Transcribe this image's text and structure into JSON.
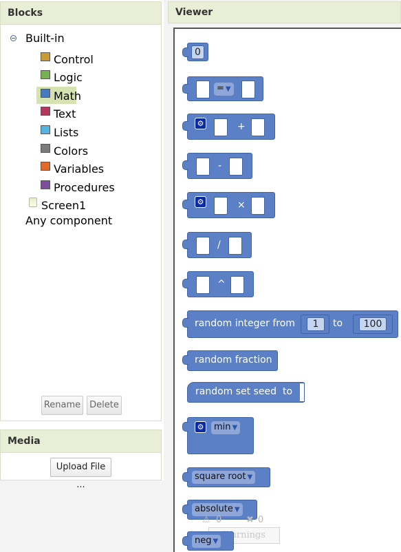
{
  "blocks_panel": {
    "title": "Blocks",
    "builtin_label": "Built-in",
    "categories": [
      {
        "label": "Control",
        "color": "#c99a38"
      },
      {
        "label": "Logic",
        "color": "#77b150"
      },
      {
        "label": "Math",
        "color": "#4a79c4"
      },
      {
        "label": "Text",
        "color": "#b3385e"
      },
      {
        "label": "Lists",
        "color": "#54b3e0"
      },
      {
        "label": "Colors",
        "color": "#7b7b7b"
      },
      {
        "label": "Variables",
        "color": "#e06a2c"
      },
      {
        "label": "Procedures",
        "color": "#7d4f9a"
      }
    ],
    "selected": "Math",
    "screen_label": "Screen1",
    "any_component": "Any component",
    "rename_label": "Rename",
    "delete_label": "Delete"
  },
  "media_panel": {
    "title": "Media",
    "upload_label": "Upload File ..."
  },
  "viewer": {
    "title": "Viewer",
    "blocks": {
      "number_value": "0",
      "compare_op": "=",
      "add_op": "+",
      "subtract_op": "-",
      "multiply_op": "×",
      "divide_op": "/",
      "power_op": "^",
      "random_int_label": "random integer from",
      "random_int_from": "1",
      "random_int_to_label": "to",
      "random_int_to": "100",
      "random_fraction_label": "random fraction",
      "random_seed_label": "random set seed",
      "random_seed_to_label": "to",
      "min_label": "min",
      "square_root_label": "square root",
      "absolute_label": "absolute",
      "neg_label": "neg"
    },
    "warnings": {
      "warn_count": "0",
      "error_count": "0",
      "button_label": "Warnings"
    },
    "block_color": "#5b80c5"
  }
}
